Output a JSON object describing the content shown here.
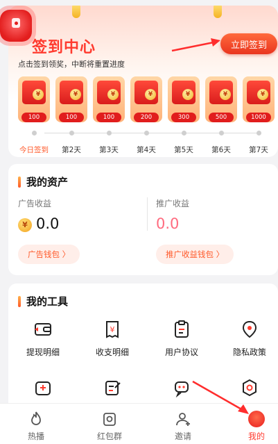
{
  "checkin": {
    "title": "签到中心",
    "subtitle": "点击签到领奖，中断将重置进度",
    "sign_button": "立即签到",
    "days": [
      {
        "label": "今日签到",
        "amount": "100"
      },
      {
        "label": "第2天",
        "amount": "100"
      },
      {
        "label": "第3天",
        "amount": "100"
      },
      {
        "label": "第4天",
        "amount": "200"
      },
      {
        "label": "第5天",
        "amount": "300"
      },
      {
        "label": "第6天",
        "amount": "500"
      },
      {
        "label": "第7天",
        "amount": "1000"
      }
    ]
  },
  "assets": {
    "title": "我的资产",
    "ad_income_label": "广告收益",
    "ad_income_value": "0.0",
    "promo_income_label": "推广收益",
    "promo_income_value": "0.0",
    "ad_wallet_button": "广告钱包 〉",
    "promo_wallet_button": "推广收益钱包 〉",
    "coin_symbol": "¥"
  },
  "tools": {
    "title": "我的工具",
    "items": [
      {
        "label": "提现明细",
        "icon": "wallet-icon"
      },
      {
        "label": "收支明细",
        "icon": "receipt-icon"
      },
      {
        "label": "用户协议",
        "icon": "document-icon"
      },
      {
        "label": "隐私政策",
        "icon": "location-shield-icon"
      },
      {
        "label": "",
        "icon": "add-card-icon"
      },
      {
        "label": "",
        "icon": "edit-note-icon"
      },
      {
        "label": "",
        "icon": "support-chat-icon"
      },
      {
        "label": "",
        "icon": "settings-hex-icon"
      }
    ]
  },
  "tabbar": {
    "items": [
      {
        "label": "热播",
        "icon": "flame-icon"
      },
      {
        "label": "红包群",
        "icon": "red-packet-group-icon"
      },
      {
        "label": "邀请",
        "icon": "invite-user-icon"
      },
      {
        "label": "我的",
        "icon": "profile-icon"
      }
    ]
  },
  "colors": {
    "accent": "#ff3b2f",
    "button": "#e9351f",
    "pink_value": "#ff6b7f",
    "pill_bg": "#ffeee9"
  }
}
